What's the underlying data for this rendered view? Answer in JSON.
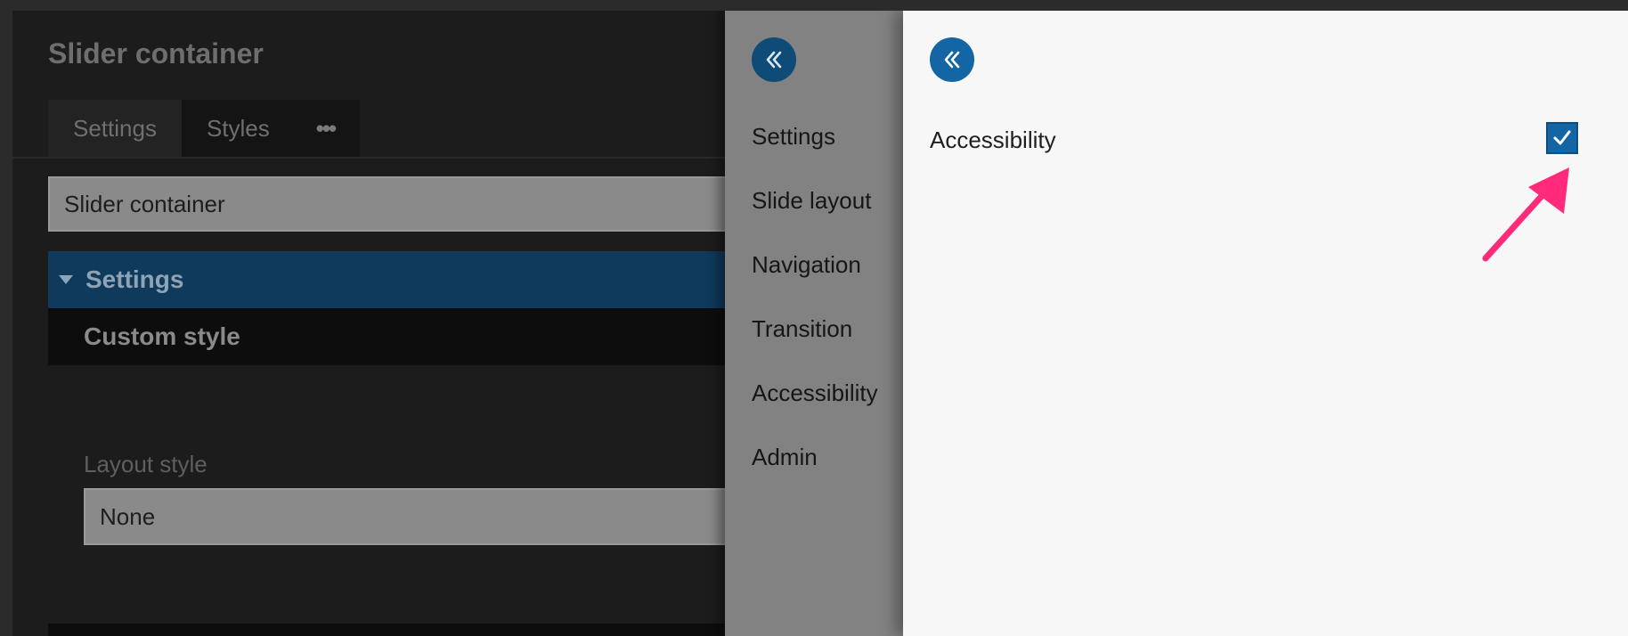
{
  "editor": {
    "title": "Slider container",
    "tabs": [
      {
        "label": "Settings",
        "active": true
      },
      {
        "label": "Styles",
        "active": false
      }
    ],
    "more_label": "•••",
    "name_field_value": "Slider container",
    "accordion": {
      "label": "Settings",
      "expanded": true
    },
    "custom_style_label": "Custom style",
    "layout_style": {
      "label": "Layout style",
      "value": "None"
    }
  },
  "nav": {
    "collapse_icon": "chevrons-left-icon",
    "items": [
      {
        "label": "Settings"
      },
      {
        "label": "Slide layout"
      },
      {
        "label": "Navigation"
      },
      {
        "label": "Transition"
      },
      {
        "label": "Accessibility"
      },
      {
        "label": "Admin"
      }
    ]
  },
  "content": {
    "collapse_icon": "chevrons-left-icon",
    "setting": {
      "label": "Accessibility",
      "checked": true
    }
  },
  "colors": {
    "accent": "#1465a4",
    "annotation_arrow": "#ff2a7a",
    "accordion_header": "#0f3a5c"
  }
}
